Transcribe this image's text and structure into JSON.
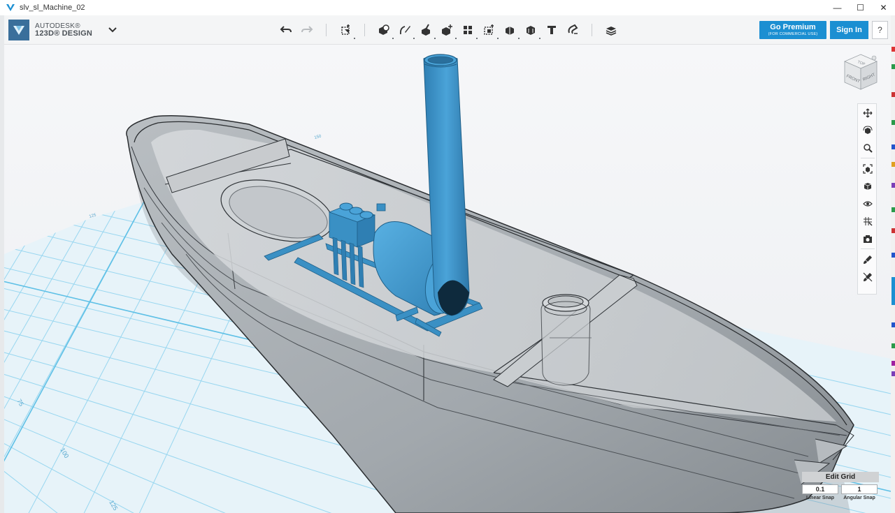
{
  "window": {
    "title": "slv_sl_Machine_02",
    "minimize": "—",
    "maximize": "☐",
    "close": "✕"
  },
  "app": {
    "brand_line1": "AUTODESK®",
    "brand_line2": "123D® DESIGN"
  },
  "toolbar": {
    "tools": [
      {
        "id": "undo",
        "icon": "undo-icon"
      },
      {
        "id": "redo",
        "icon": "redo-icon"
      },
      {
        "id": "transform",
        "icon": "transform-icon"
      },
      {
        "id": "primitives",
        "icon": "primitives-icon"
      },
      {
        "id": "sketch",
        "icon": "sketch-icon"
      },
      {
        "id": "construct",
        "icon": "construct-icon"
      },
      {
        "id": "modify",
        "icon": "modify-icon"
      },
      {
        "id": "pattern",
        "icon": "pattern-icon"
      },
      {
        "id": "grouping",
        "icon": "grouping-icon"
      },
      {
        "id": "combine",
        "icon": "combine-icon"
      },
      {
        "id": "measure",
        "icon": "measure-icon"
      },
      {
        "id": "text",
        "icon": "text-icon"
      },
      {
        "id": "snap",
        "icon": "snap-icon"
      },
      {
        "id": "material",
        "icon": "material-icon"
      }
    ]
  },
  "account": {
    "premium_label": "Go Premium",
    "premium_sub": "(FOR COMMERCIAL USE)",
    "signin_label": "Sign In",
    "help_label": "?"
  },
  "viewcube": {
    "top": "TOP",
    "front": "FRONT",
    "right": "RIGHT"
  },
  "navbar": [
    {
      "id": "pan",
      "icon": "pan-icon"
    },
    {
      "id": "orbit",
      "icon": "orbit-icon"
    },
    {
      "id": "zoom",
      "icon": "zoom-icon"
    },
    {
      "id": "fit",
      "icon": "fit-icon"
    },
    {
      "id": "view-mode",
      "icon": "cube-view-icon"
    },
    {
      "id": "visibility",
      "icon": "eye-icon"
    },
    {
      "id": "grid-toggle",
      "icon": "grid-icon"
    },
    {
      "id": "screenshot",
      "icon": "camera-icon"
    },
    {
      "id": "material-paint",
      "icon": "brush-icon"
    },
    {
      "id": "material-clear",
      "icon": "brush-clear-icon"
    }
  ],
  "grid": {
    "edit_label": "Edit Grid",
    "linear_value": "0.1",
    "angular_value": "1",
    "linear_label": "Linear Snap",
    "angular_label": "Angular Snap",
    "ruler_labels": [
      "75",
      "100",
      "125"
    ],
    "far_ruler_labels": [
      "125",
      "150"
    ]
  },
  "colors": {
    "accent": "#1b8fd2",
    "model_blue": "#3a90c4",
    "grid_line": "#8fd3ef",
    "hull_gray": "#9aa0a5"
  }
}
